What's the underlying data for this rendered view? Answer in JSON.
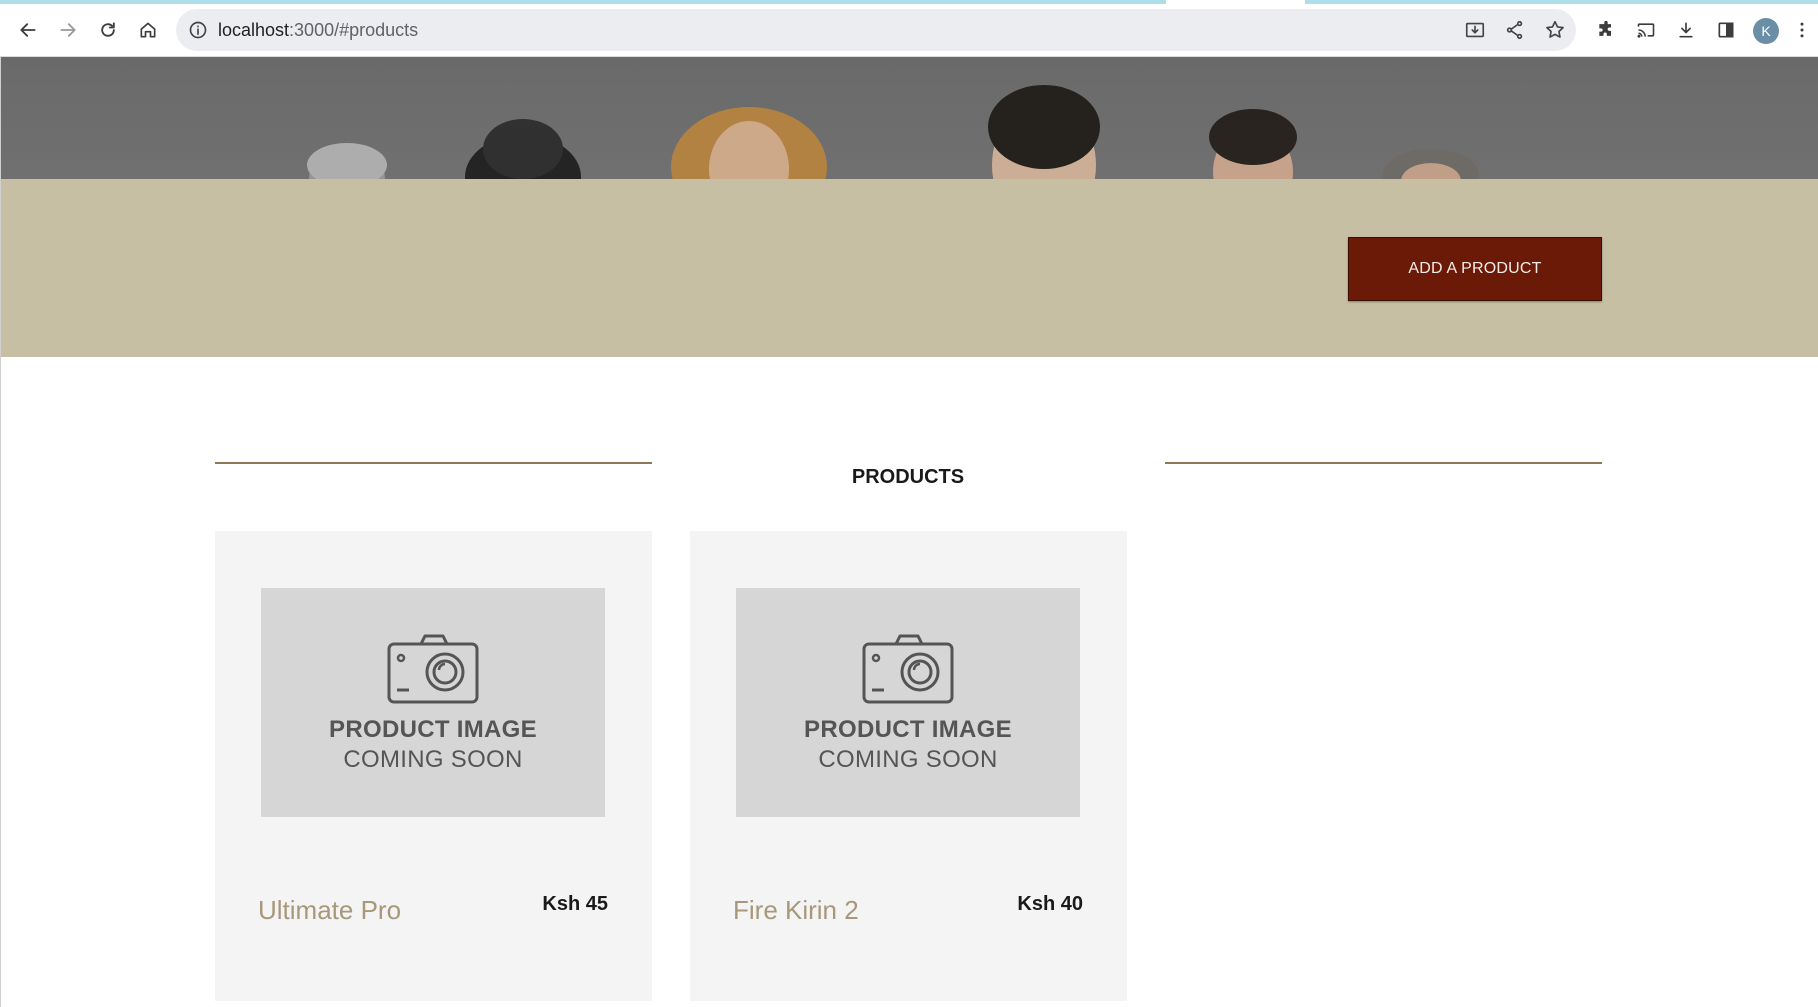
{
  "browser": {
    "url_host": "localhost",
    "url_path": ":3000/#products",
    "profile_initial": "K",
    "icons": [
      "back-icon",
      "forward-icon",
      "reload-icon",
      "home-icon",
      "info-icon",
      "install-icon",
      "share-icon",
      "bookmark-star-icon",
      "extensions-icon",
      "cast-icon",
      "download-icon",
      "side-panel-icon",
      "menu-icon"
    ]
  },
  "header": {
    "add_product_label": "ADD A PRODUCT"
  },
  "section": {
    "title": "PRODUCTS"
  },
  "products": [
    {
      "name": "Ultimate Pro",
      "price": "Ksh 45",
      "placeholder_line1": "PRODUCT IMAGE",
      "placeholder_line2": "COMING SOON"
    },
    {
      "name": "Fire Kirin 2",
      "price": "Ksh 40",
      "placeholder_line1": "PRODUCT IMAGE",
      "placeholder_line2": "COMING SOON"
    }
  ],
  "colors": {
    "band": "#c7bfa4",
    "button": "#6b1a08",
    "product_name": "#a8987a",
    "divider": "#8d7a55"
  }
}
